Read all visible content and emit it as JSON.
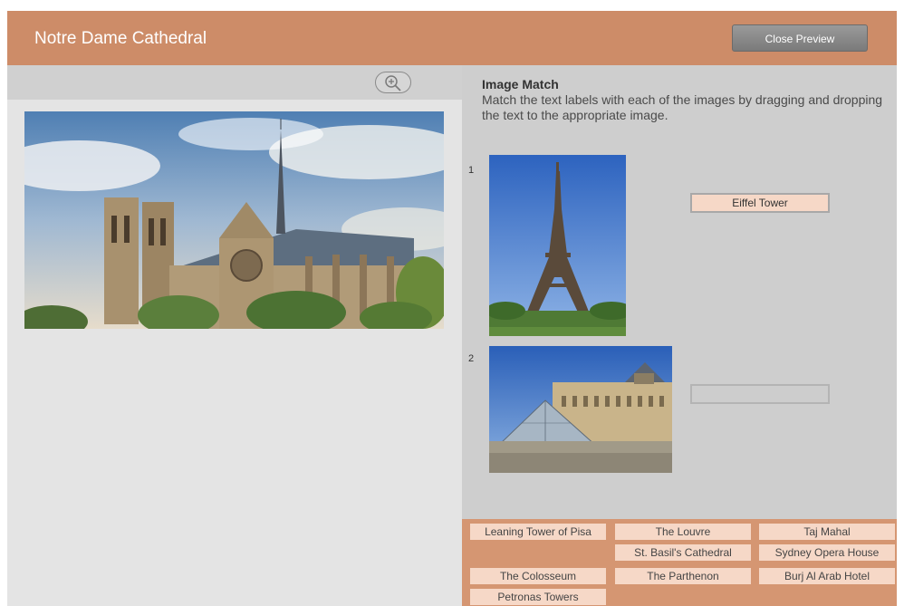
{
  "header": {
    "title": "Notre Dame Cathedral",
    "close_label": "Close Preview"
  },
  "left": {
    "zoom_icon": "zoom-in-icon",
    "image": "notre-dame-cathedral-photo"
  },
  "activity": {
    "title": "Image Match",
    "instructions": "Match the text labels with each of the images by dragging and dropping the text to the appropriate image.",
    "items": [
      {
        "number": "1",
        "image": "eiffel-tower-photo",
        "answer": "Eiffel Tower"
      },
      {
        "number": "2",
        "image": "louvre-pyramid-photo",
        "answer": ""
      }
    ]
  },
  "word_bank": [
    "Leaning Tower of Pisa",
    "The Louvre",
    "Taj Mahal",
    "St. Basil's Cathedral",
    "Sydney Opera House",
    "The Colosseum",
    "The Parthenon",
    "Burj Al Arab Hotel",
    "Petronas Towers"
  ],
  "colors": {
    "header": "#cd8c68",
    "word_bank": "#d59672",
    "chip": "#f6d8c7",
    "left_panel": "#e4e4e4",
    "right_panel": "#cecece"
  }
}
